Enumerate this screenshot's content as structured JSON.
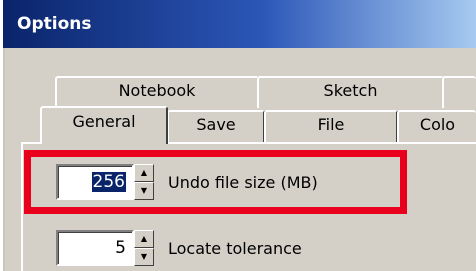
{
  "window": {
    "title": "Options"
  },
  "tabs": {
    "row1": [
      {
        "label": "Notebook"
      },
      {
        "label": "Sketch"
      }
    ],
    "row2": [
      {
        "label": "General"
      },
      {
        "label": "Save"
      },
      {
        "label": "File"
      },
      {
        "label": "Colo"
      }
    ]
  },
  "fields": [
    {
      "value": "256",
      "label": "Undo file size (MB)"
    },
    {
      "value": "5",
      "label": "Locate tolerance"
    }
  ],
  "icons": {
    "spin_up": "spin-up-arrow-icon",
    "spin_down": "spin-down-arrow-icon"
  },
  "colors": {
    "highlight": "#e8001c",
    "title_bar": "#0a246a",
    "dialog_bg": "#d4d0c8"
  }
}
